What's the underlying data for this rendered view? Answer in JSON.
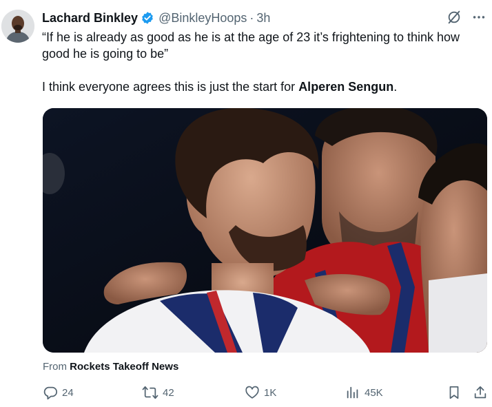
{
  "tweet": {
    "author": {
      "display_name": "Lachard Binkley",
      "verified": true,
      "handle": "@BinkleyHoops",
      "separator": "·",
      "time": "3h"
    },
    "text": {
      "quote": "“If he is already as good as he is at the age of 23 it’s frightening to think how good he is going to be”",
      "line2_prefix": "I think everyone agrees this is just the start for ",
      "line2_bold": "Alperen Sengun",
      "line2_suffix": "."
    },
    "media": {
      "description_icon": "photo"
    },
    "source": {
      "prefix": "From ",
      "name": "Rockets Takeoff News"
    },
    "metrics": {
      "replies": "24",
      "reposts": "42",
      "likes": "1K",
      "views": "45K"
    },
    "icons": {
      "verified": "verified-badge-icon",
      "grok": "grok-icon",
      "more": "more-icon",
      "reply": "reply-icon",
      "repost": "repost-icon",
      "like": "heart-icon",
      "views": "views-icon",
      "bookmark": "bookmark-icon",
      "share": "share-icon"
    },
    "colors": {
      "accent": "#1d9bf0",
      "secondary_text": "#536471",
      "primary_text": "#0f1419"
    }
  }
}
